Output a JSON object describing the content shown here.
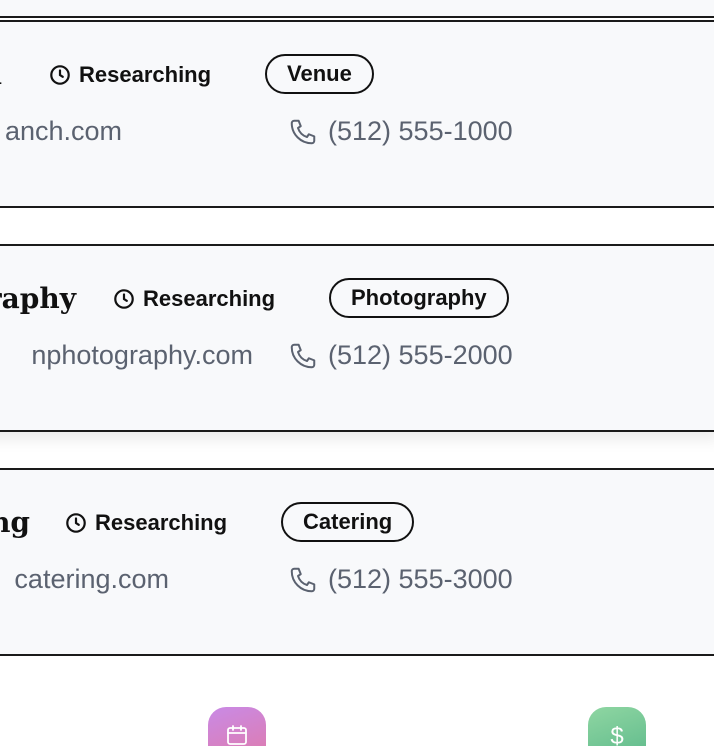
{
  "vendors": [
    {
      "name": "n",
      "status": "Researching",
      "category": "Venue",
      "website": "anch.com",
      "phone": "(512) 555-1000"
    },
    {
      "name": "raphy",
      "status": "Researching",
      "category": "Photography",
      "website": "nphotography.com",
      "phone": "(512) 555-2000"
    },
    {
      "name": "ng",
      "status": "Researching",
      "category": "Catering",
      "website": "catering.com",
      "phone": "(512) 555-3000"
    }
  ],
  "bottom_nav": {
    "items": [
      {
        "icon": "calendar-icon",
        "color": "#d27fc4"
      },
      {
        "icon": "dollar-icon",
        "glyph": "$",
        "color": "#6cc295"
      }
    ]
  },
  "colors": {
    "card_background": "#f8f9fb",
    "card_border": "#1a1a1a",
    "secondary_text": "#5b6270",
    "primary_text": "#111111"
  }
}
